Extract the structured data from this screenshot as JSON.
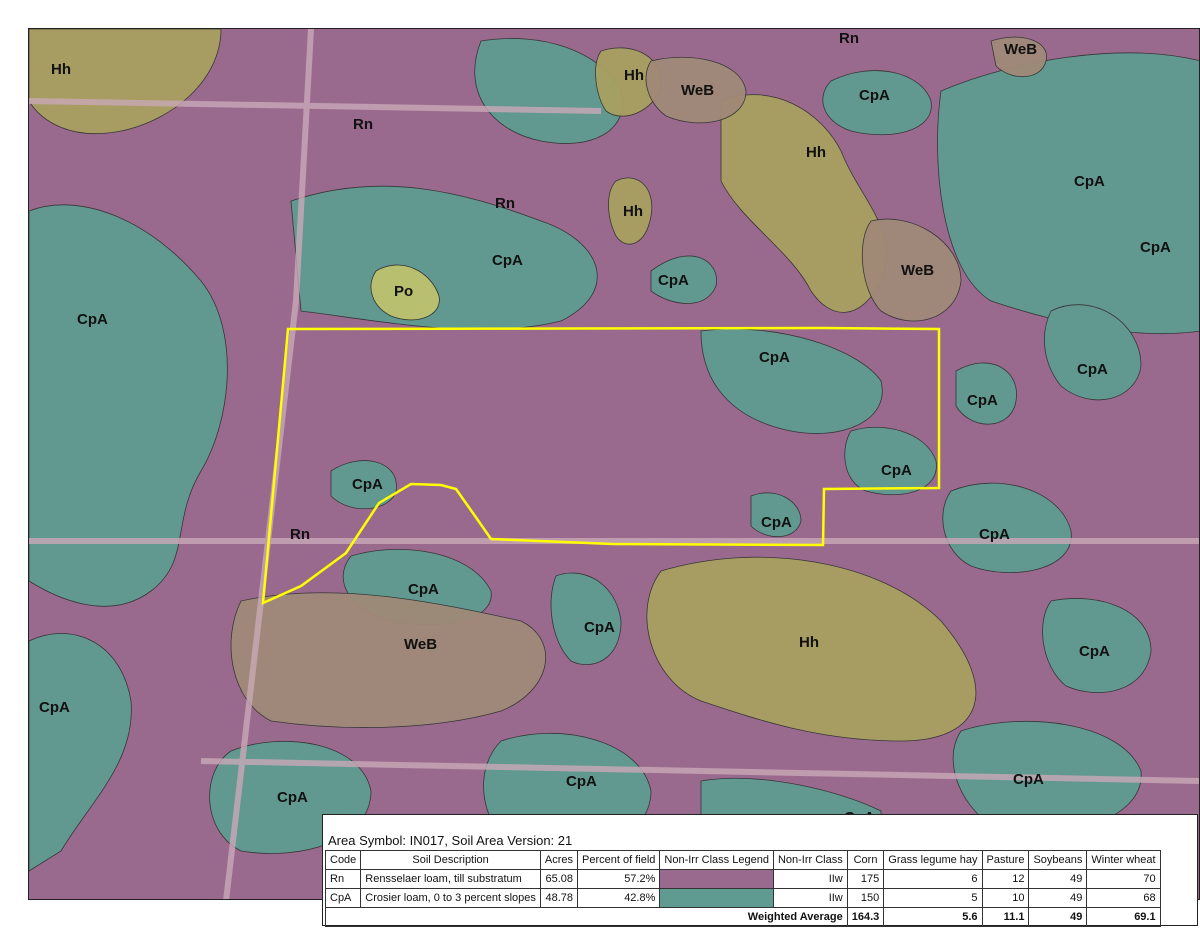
{
  "colors": {
    "crosier": "#5f9b91",
    "rensselaer": "#9a6a8e",
    "hh": "#a8a060",
    "web": "#a08a78",
    "po": "#b8c070",
    "field_boundary": "#ffff00"
  },
  "map_labels": {
    "hh1": "Hh",
    "rn_top": "Rn",
    "web_top": "WeB",
    "hh2": "Hh",
    "web2": "WeB",
    "cpa_top": "CpA",
    "rn2": "Rn",
    "hh3": "Hh",
    "cpa_right1": "CpA",
    "rn3": "Rn",
    "hh4": "Hh",
    "cpa_right2": "CpA",
    "cpa_mid": "CpA",
    "web3": "WeB",
    "po": "Po",
    "cpa_mid2": "CpA",
    "cpa_left": "CpA",
    "cpa_field1": "CpA",
    "cpa_right3": "CpA",
    "cpa_right4": "CpA",
    "cpa_field2": "CpA",
    "cpa_field3": "CpA",
    "rn_field": "Rn",
    "cpa_field4": "CpA",
    "cpa_right5": "CpA",
    "cpa_s1": "CpA",
    "cpa_s2": "CpA",
    "web4": "WeB",
    "hh5": "Hh",
    "cpa_s3": "CpA",
    "cpa_left2": "CpA",
    "cpa_bot1": "CpA",
    "cpa_bot2": "CpA",
    "cpa_bot3": "CpA",
    "cpa_bot_partial": "CpA"
  },
  "legend": {
    "header": "Area Symbol: IN017, Soil Area Version: 21",
    "columns": [
      "Code",
      "Soil Description",
      "Acres",
      "Percent of field",
      "Non-Irr Class Legend",
      "Non-Irr Class",
      "Corn",
      "Grass legume hay",
      "Pasture",
      "Soybeans",
      "Winter wheat"
    ],
    "rows": [
      {
        "code": "Rn",
        "desc": "Rensselaer loam, till substratum",
        "acres": "65.08",
        "percent": "57.2%",
        "class": "IIw",
        "corn": "175",
        "hay": "6",
        "pasture": "12",
        "soybeans": "49",
        "wheat": "70"
      },
      {
        "code": "CpA",
        "desc": "Crosier loam, 0 to 3 percent slopes",
        "acres": "48.78",
        "percent": "42.8%",
        "class": "IIw",
        "corn": "150",
        "hay": "5",
        "pasture": "10",
        "soybeans": "49",
        "wheat": "68"
      }
    ],
    "weighted": {
      "label": "Weighted Average",
      "corn": "164.3",
      "hay": "5.6",
      "pasture": "11.1",
      "soybeans": "49",
      "wheat": "69.1"
    }
  }
}
